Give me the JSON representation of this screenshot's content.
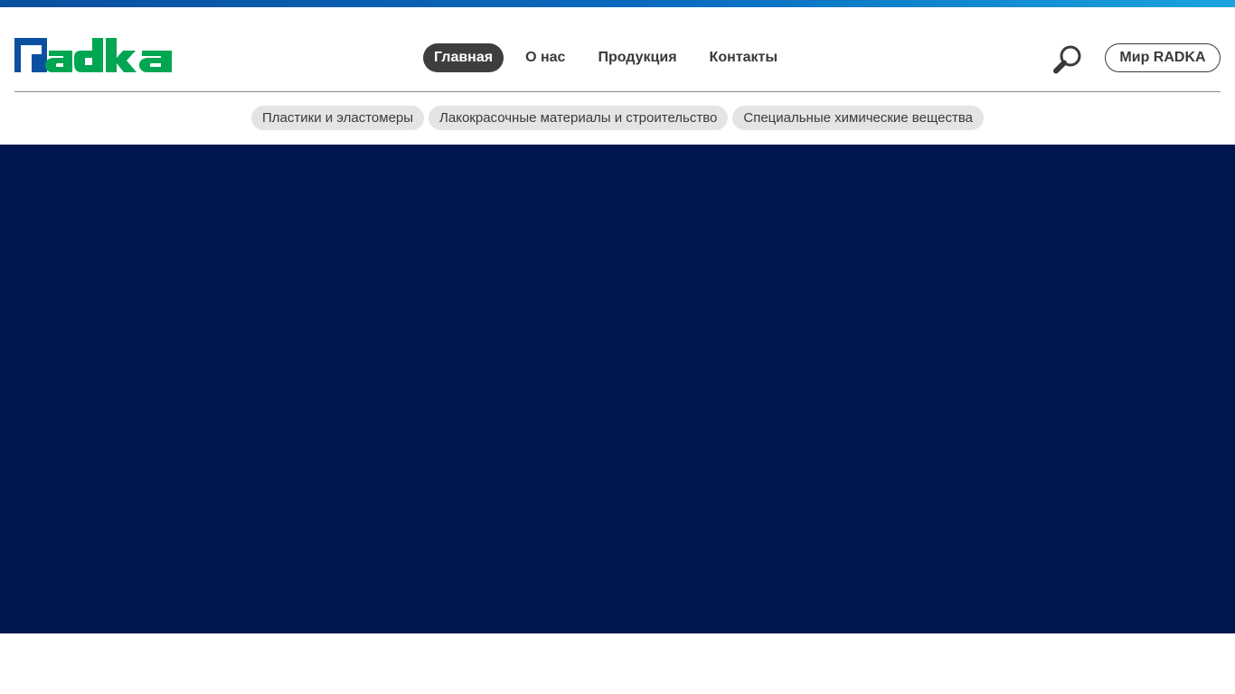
{
  "brand": {
    "name": "radka",
    "colors": {
      "blue": "#0a4fa0",
      "green": "#00a651",
      "hero": "#00164f",
      "text": "#3a3a3a",
      "active_pill": "#3e3e3e",
      "chip_bg": "#e4e4e2"
    }
  },
  "nav": {
    "items": [
      {
        "label": "Главная",
        "active": true
      },
      {
        "label": "О нас",
        "active": false
      },
      {
        "label": "Продукция",
        "active": false
      },
      {
        "label": "Контакты",
        "active": false
      }
    ]
  },
  "header": {
    "search_icon": "search-icon",
    "world_button": "Мир RADKA"
  },
  "subnav": {
    "items": [
      "Пластики и эластомеры",
      "Лакокрасочные материалы и строительство",
      "Специальные химические вещества"
    ]
  }
}
